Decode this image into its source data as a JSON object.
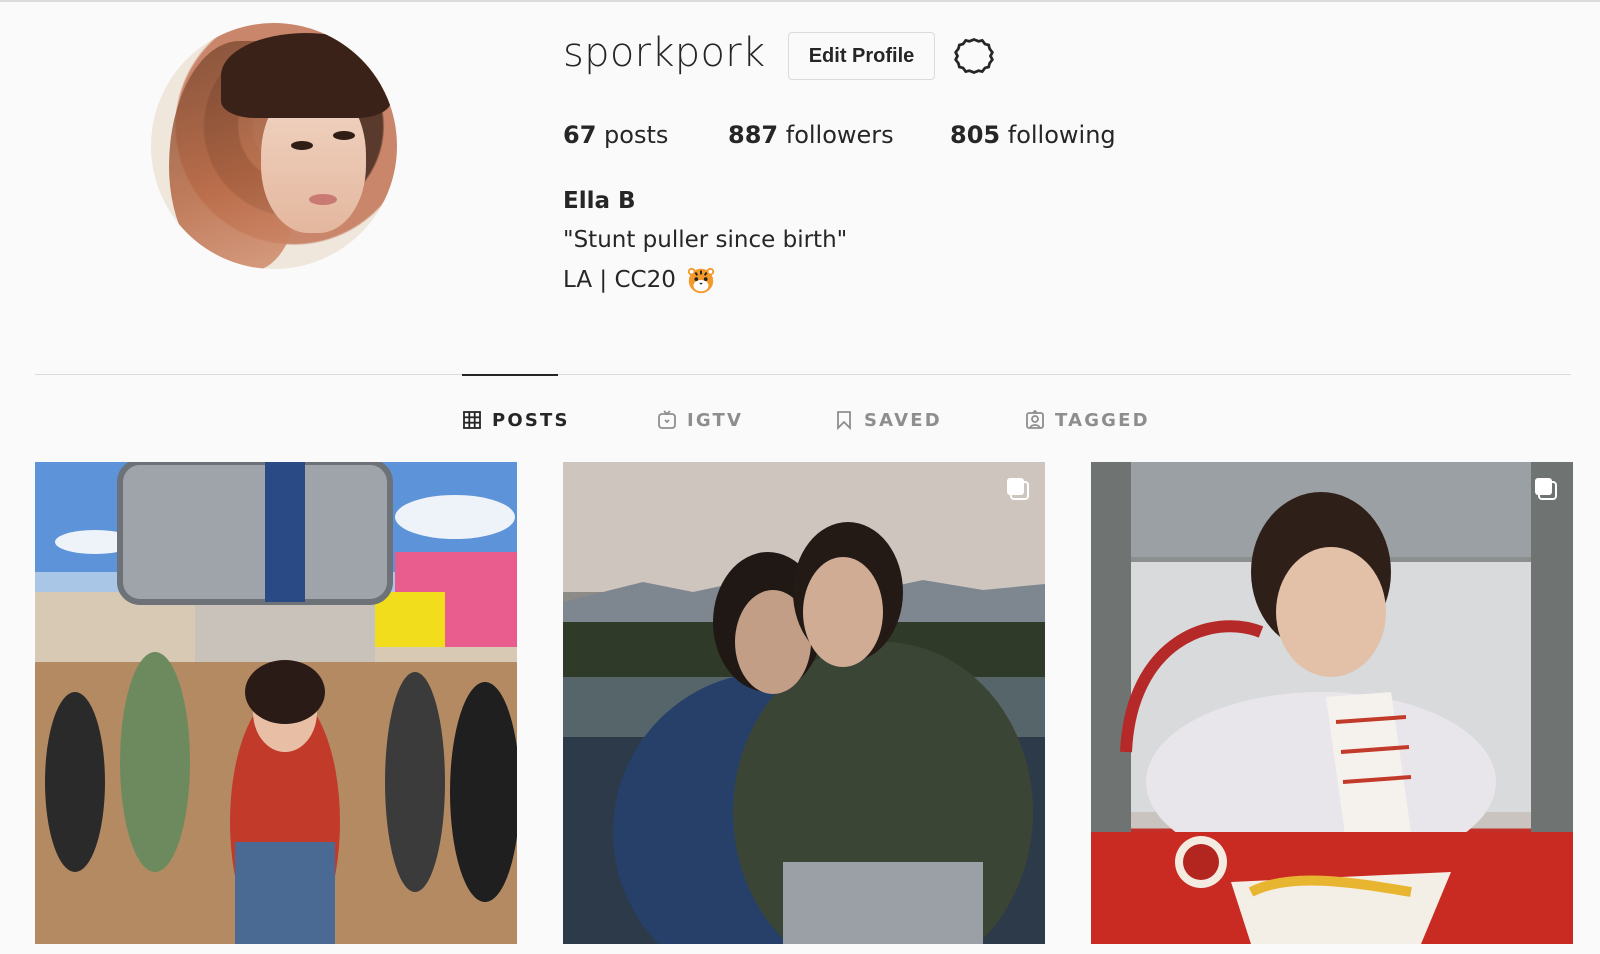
{
  "profile": {
    "username": "sporkpork",
    "edit_label": "Edit Profile",
    "settings_icon": "gear-icon",
    "stats": {
      "posts_count": "67",
      "posts_label": "posts",
      "followers_count": "887",
      "followers_label": "followers",
      "following_count": "805",
      "following_label": "following"
    },
    "full_name": "Ella B",
    "bio_line1": "\"Stunt puller since birth\"",
    "bio_line2": "LA | CC20",
    "bio_emoji": "tiger-face-icon"
  },
  "tabs": [
    {
      "label": "POSTS",
      "icon": "grid-icon",
      "active": true
    },
    {
      "label": "IGTV",
      "icon": "igtv-icon",
      "active": false
    },
    {
      "label": "SAVED",
      "icon": "bookmark-icon",
      "active": false
    },
    {
      "label": "TAGGED",
      "icon": "tagged-icon",
      "active": false
    }
  ],
  "posts": [
    {
      "type": "photo",
      "multi": false
    },
    {
      "type": "photo",
      "multi": true
    },
    {
      "type": "photo",
      "multi": true
    }
  ],
  "colors": {
    "background": "#fafafa",
    "text": "#262626",
    "muted": "#8e8e8e",
    "border": "#dbdbdb"
  }
}
